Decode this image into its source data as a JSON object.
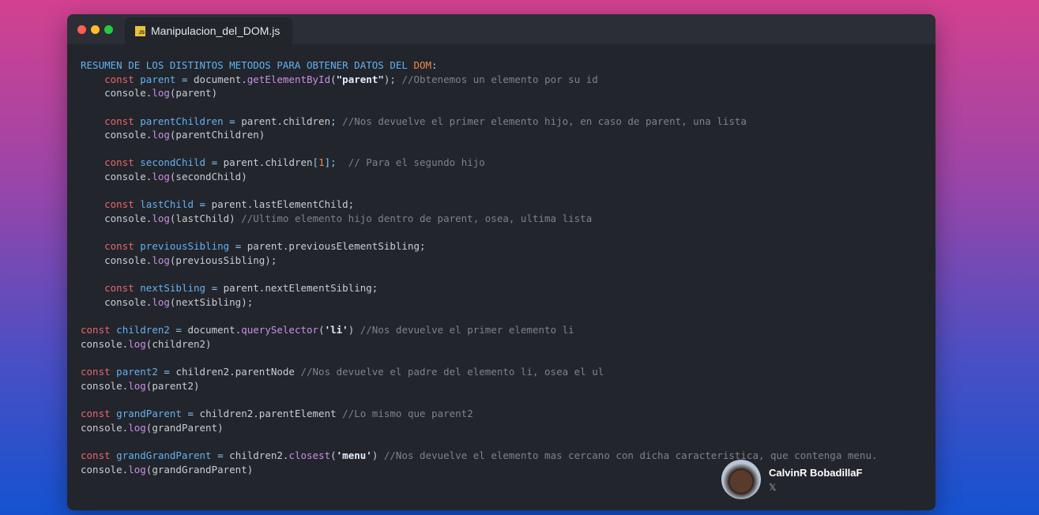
{
  "window": {
    "tab_label": "Manipulacion_del_DOM.js",
    "tab_icon_text": "JS",
    "dots": [
      "#ff5f56",
      "#ffbd2e",
      "#27c93f"
    ]
  },
  "code": [
    [
      [
        "h",
        "RESUMEN DE LOS DISTINTOS METODOS PARA OBTENER DATOS DEL "
      ],
      [
        "d",
        "DOM"
      ],
      [
        "p",
        ":"
      ]
    ],
    [
      [
        "p",
        "    "
      ],
      [
        "k",
        "const"
      ],
      [
        "p",
        " "
      ],
      [
        "v",
        "parent"
      ],
      [
        "o",
        " = "
      ],
      [
        "p",
        "document."
      ],
      [
        "f",
        "getElementById"
      ],
      [
        "p",
        "("
      ],
      [
        "s",
        "\"parent\""
      ],
      [
        "p",
        ")"
      ],
      [
        "o",
        ";"
      ],
      [
        "c",
        " //Obtenemos un elemento por su id"
      ]
    ],
    [
      [
        "p",
        "    console."
      ],
      [
        "f",
        "log"
      ],
      [
        "p",
        "(parent)"
      ]
    ],
    [],
    [
      [
        "p",
        "    "
      ],
      [
        "k",
        "const"
      ],
      [
        "p",
        " "
      ],
      [
        "v",
        "parentChildren"
      ],
      [
        "o",
        " = "
      ],
      [
        "p",
        "parent.children"
      ],
      [
        "o",
        ";"
      ],
      [
        "c",
        " //Nos devuelve el primer elemento hijo, en caso de parent, una lista"
      ]
    ],
    [
      [
        "p",
        "    console."
      ],
      [
        "f",
        "log"
      ],
      [
        "p",
        "(parentChildren)"
      ]
    ],
    [],
    [
      [
        "p",
        "    "
      ],
      [
        "k",
        "const"
      ],
      [
        "p",
        " "
      ],
      [
        "v",
        "secondChild"
      ],
      [
        "o",
        " = "
      ],
      [
        "p",
        "parent.children"
      ],
      [
        "o",
        "["
      ],
      [
        "d",
        "1"
      ],
      [
        "o",
        "];"
      ],
      [
        "c",
        "  // Para el segundo hijo"
      ]
    ],
    [
      [
        "p",
        "    console."
      ],
      [
        "f",
        "log"
      ],
      [
        "p",
        "(secondChild)"
      ]
    ],
    [],
    [
      [
        "p",
        "    "
      ],
      [
        "k",
        "const"
      ],
      [
        "p",
        " "
      ],
      [
        "v",
        "lastChild"
      ],
      [
        "o",
        " = "
      ],
      [
        "p",
        "parent.lastElementChild;"
      ]
    ],
    [
      [
        "p",
        "    console."
      ],
      [
        "f",
        "log"
      ],
      [
        "p",
        "(lastChild)"
      ],
      [
        "c",
        " //Ultimo elemento hijo dentro de parent, osea, ultima lista"
      ]
    ],
    [],
    [
      [
        "p",
        "    "
      ],
      [
        "k",
        "const"
      ],
      [
        "p",
        " "
      ],
      [
        "v",
        "previousSibling"
      ],
      [
        "o",
        " = "
      ],
      [
        "p",
        "parent.previousElementSibling;"
      ]
    ],
    [
      [
        "p",
        "    console."
      ],
      [
        "f",
        "log"
      ],
      [
        "p",
        "(previousSibling);"
      ]
    ],
    [],
    [
      [
        "p",
        "    "
      ],
      [
        "k",
        "const"
      ],
      [
        "p",
        " "
      ],
      [
        "v",
        "nextSibling"
      ],
      [
        "o",
        " = "
      ],
      [
        "p",
        "parent.nextElementSibling;"
      ]
    ],
    [
      [
        "p",
        "    console."
      ],
      [
        "f",
        "log"
      ],
      [
        "p",
        "(nextSibling);"
      ]
    ],
    [],
    [
      [
        "k",
        "const"
      ],
      [
        "p",
        " "
      ],
      [
        "v",
        "children2"
      ],
      [
        "o",
        " = "
      ],
      [
        "p",
        "document."
      ],
      [
        "f",
        "querySelector"
      ],
      [
        "p",
        "("
      ],
      [
        "s",
        "'li'"
      ],
      [
        "p",
        ")"
      ],
      [
        "c",
        " //Nos devuelve el primer elemento li"
      ]
    ],
    [
      [
        "p",
        "console."
      ],
      [
        "f",
        "log"
      ],
      [
        "p",
        "(children2)"
      ]
    ],
    [],
    [
      [
        "k",
        "const"
      ],
      [
        "p",
        " "
      ],
      [
        "v",
        "parent2"
      ],
      [
        "o",
        " = "
      ],
      [
        "p",
        "children2.parentNode"
      ],
      [
        "c",
        " //Nos devuelve el padre del elemento li, osea el ul"
      ]
    ],
    [
      [
        "p",
        "console."
      ],
      [
        "f",
        "log"
      ],
      [
        "p",
        "(parent2)"
      ]
    ],
    [],
    [
      [
        "k",
        "const"
      ],
      [
        "p",
        " "
      ],
      [
        "v",
        "grandParent"
      ],
      [
        "o",
        " = "
      ],
      [
        "p",
        "children2.parentElement"
      ],
      [
        "c",
        " //Lo mismo que parent2"
      ]
    ],
    [
      [
        "p",
        "console."
      ],
      [
        "f",
        "log"
      ],
      [
        "p",
        "(grandParent)"
      ]
    ],
    [],
    [
      [
        "k",
        "const"
      ],
      [
        "p",
        " "
      ],
      [
        "v",
        "grandGrandParent"
      ],
      [
        "o",
        " = "
      ],
      [
        "p",
        "children2."
      ],
      [
        "f",
        "closest"
      ],
      [
        "p",
        "("
      ],
      [
        "s",
        "'menu'"
      ],
      [
        "p",
        ")"
      ],
      [
        "c",
        " //Nos devuelve el elemento mas cercano con dicha caracteristica, que contenga menu."
      ]
    ],
    [
      [
        "p",
        "console."
      ],
      [
        "f",
        "log"
      ],
      [
        "p",
        "(grandGrandParent)"
      ]
    ]
  ],
  "author": {
    "name": "CalvinR BobadillaF",
    "social": "𝕏"
  }
}
